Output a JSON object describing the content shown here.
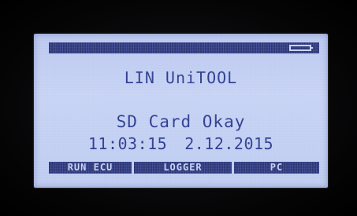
{
  "screen": {
    "title": "LIN UniTOOL",
    "status": "SD Card Okay",
    "time": "11:03:15",
    "date": "2.12.2015",
    "battery_icon": "battery-icon"
  },
  "softkeys": [
    {
      "label": "RUN ECU"
    },
    {
      "label": "LOGGER"
    },
    {
      "label": "PC"
    }
  ],
  "colors": {
    "lcd_background": "#c6d2f4",
    "lcd_text": "#2b3a8f",
    "bar": "#2a3476"
  }
}
